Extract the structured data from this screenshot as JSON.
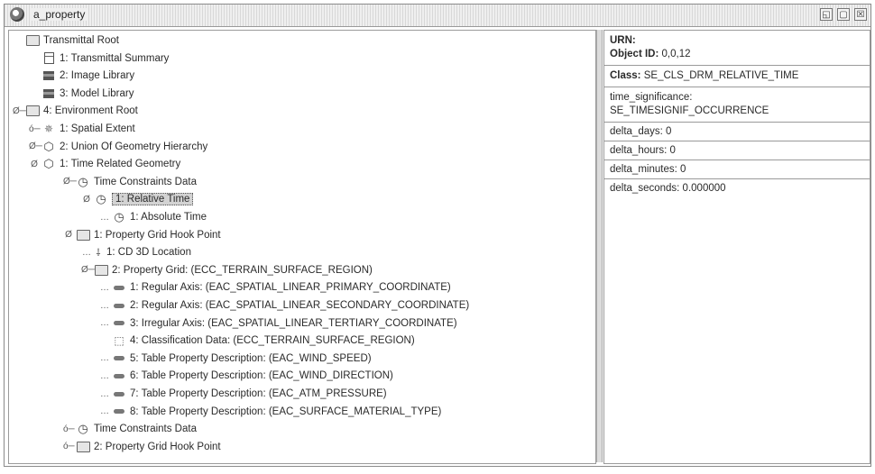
{
  "window": {
    "title": "a_property",
    "buttons": [
      "◱",
      "▢",
      "☒"
    ]
  },
  "tree": [
    {
      "label": "Transmittal Root",
      "icon": "folder",
      "handle": "",
      "level": 0
    },
    {
      "label": "1: Transmittal Summary",
      "icon": "doc",
      "handle": "",
      "level": 1
    },
    {
      "label": "2: Image Library",
      "icon": "lib",
      "handle": "",
      "level": 1
    },
    {
      "label": "3: Model Library",
      "icon": "lib",
      "handle": "",
      "level": 1
    },
    {
      "label": "4: Environment Root",
      "icon": "folder",
      "handle": "Ø─",
      "level": 0
    },
    {
      "label": "1: Spatial Extent",
      "icon": "star",
      "handle": "ó─",
      "level": 1
    },
    {
      "label": "2: Union Of Geometry Hierarchy",
      "icon": "cube",
      "handle": "Ø─",
      "level": 1
    },
    {
      "label": "1: Time Related Geometry",
      "icon": "cube",
      "handle": "Ø",
      "level": 2
    },
    {
      "label": "Time Constraints Data",
      "icon": "clock",
      "handle": "Ø─",
      "level": 3
    },
    {
      "label": "1: Relative Time",
      "icon": "clock",
      "handle": "Ø",
      "level": 4,
      "selected": true
    },
    {
      "label": "1: Absolute Time",
      "icon": "clock",
      "handle": "…",
      "level": 5
    },
    {
      "label": "1: Property Grid Hook Point",
      "icon": "folder",
      "handle": "Ø",
      "level": 3
    },
    {
      "label": "1: CD 3D Location",
      "icon": "loc",
      "handle": "…",
      "level": 4
    },
    {
      "label": "2: Property Grid: (ECC_TERRAIN_SURFACE_REGION)",
      "icon": "folder",
      "handle": "Ø─",
      "level": 4
    },
    {
      "label": "1: Regular Axis: (EAC_SPATIAL_LINEAR_PRIMARY_COORDINATE)",
      "icon": "pill",
      "handle": "…",
      "level": 5
    },
    {
      "label": "2: Regular Axis: (EAC_SPATIAL_LINEAR_SECONDARY_COORDINATE)",
      "icon": "pill",
      "handle": "…",
      "level": 5
    },
    {
      "label": "3: Irregular Axis: (EAC_SPATIAL_LINEAR_TERTIARY_COORDINATE)",
      "icon": "pill",
      "handle": "…",
      "level": 5
    },
    {
      "label": "4: Classification Data: (ECC_TERRAIN_SURFACE_REGION)",
      "icon": "tag",
      "handle": "",
      "level": 5
    },
    {
      "label": "5: Table Property Description: (EAC_WIND_SPEED)",
      "icon": "pill",
      "handle": "…",
      "level": 5
    },
    {
      "label": "6: Table Property Description: (EAC_WIND_DIRECTION)",
      "icon": "pill",
      "handle": "…",
      "level": 5
    },
    {
      "label": "7: Table Property Description: (EAC_ATM_PRESSURE)",
      "icon": "pill",
      "handle": "…",
      "level": 5
    },
    {
      "label": "8: Table Property Description: (EAC_SURFACE_MATERIAL_TYPE)",
      "icon": "pill",
      "handle": "…",
      "level": 5
    },
    {
      "label": "Time Constraints Data",
      "icon": "clock",
      "handle": "ó─",
      "level": 3
    },
    {
      "label": "2: Property Grid Hook Point",
      "icon": "folder",
      "handle": "ó─",
      "level": 3
    }
  ],
  "details": {
    "urn_label": "URN:",
    "object_id_label": "Object ID:",
    "object_id_value": "0,0,12",
    "class_label": "Class:",
    "class_value": "SE_CLS_DRM_RELATIVE_TIME",
    "time_significance_label": "time_significance:",
    "time_significance_value": "SE_TIMESIGNIF_OCCURRENCE",
    "delta_days": "delta_days: 0",
    "delta_hours": "delta_hours: 0",
    "delta_minutes": "delta_minutes: 0",
    "delta_seconds": "delta_seconds: 0.000000"
  }
}
